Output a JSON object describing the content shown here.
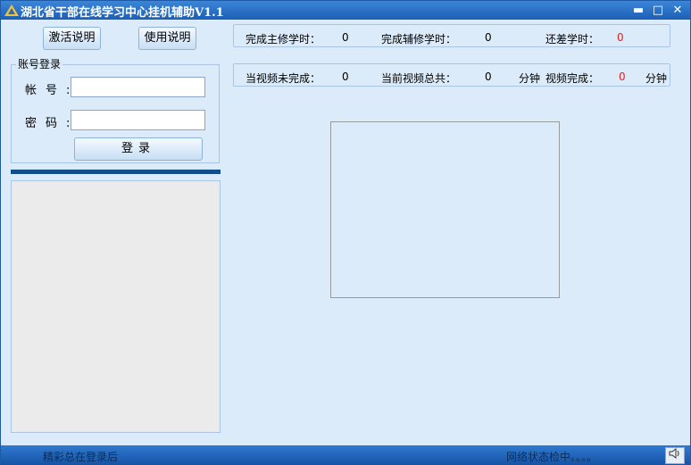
{
  "window": {
    "title": "湖北省干部在线学习中心挂机辅助V1.1",
    "controls": {
      "minimize": "▬",
      "maximize": "□",
      "close": "✕"
    },
    "icon": "app-logo-icon"
  },
  "buttons": {
    "activate_label": "激活说明",
    "usage_label": "使用说明",
    "login_label": "登录"
  },
  "login": {
    "group_title": "账号登录",
    "account_label": "帐号:",
    "password_label": "密码:",
    "account_value": "",
    "password_value": ""
  },
  "stats": {
    "row1": [
      {
        "label": "完成主修学时：",
        "value": "0"
      },
      {
        "label": "完成辅修学时：",
        "value": "0"
      },
      {
        "label": "还差学时：",
        "value": "0"
      }
    ],
    "row2": [
      {
        "label": "当视频未完成：",
        "value": "0"
      },
      {
        "label": "当前视频总共：",
        "value": "0",
        "unit": "分钟"
      },
      {
        "label": "视频完成：",
        "value": "0",
        "unit": "分钟"
      }
    ]
  },
  "status": {
    "left": "精彩总在登录后",
    "right": "网络状态检中。。。。",
    "speaker_icon": "speaker-icon"
  },
  "colors": {
    "accent_red": "#e02020",
    "title_blue": "#1c5fb5",
    "divider_navy": "#124e8c"
  }
}
